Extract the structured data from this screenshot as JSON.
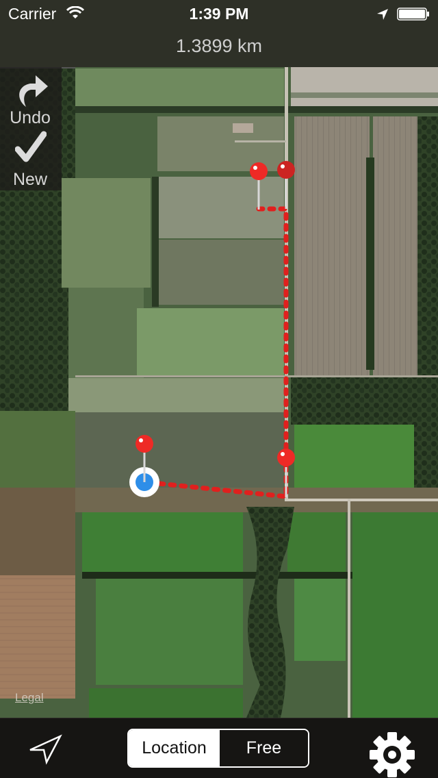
{
  "status_bar": {
    "carrier": "Carrier",
    "time": "1:39 PM",
    "wifi_icon": "wifi-icon",
    "location_icon": "location-arrow-icon",
    "battery_icon": "battery-full-icon"
  },
  "header": {
    "distance": "1.3899 km"
  },
  "side_panel": {
    "undo": {
      "label": "Undo",
      "icon": "undo-arrow-icon"
    },
    "new": {
      "label": "New",
      "icon": "checkmark-icon"
    }
  },
  "map": {
    "type": "satellite",
    "legal_label": "Legal",
    "route_color": "#e0201e",
    "pin_color": "#f02a25",
    "user_location_color": "#2e8ee8",
    "pins": [
      {
        "name": "pin-start"
      },
      {
        "name": "pin-2"
      },
      {
        "name": "pin-3"
      },
      {
        "name": "pin-4"
      }
    ]
  },
  "toolbar": {
    "track_icon": "navigation-arrow-icon",
    "segments": [
      {
        "label": "Location",
        "selected": true
      },
      {
        "label": "Free",
        "selected": false
      }
    ],
    "settings_icon": "gear-icon"
  }
}
